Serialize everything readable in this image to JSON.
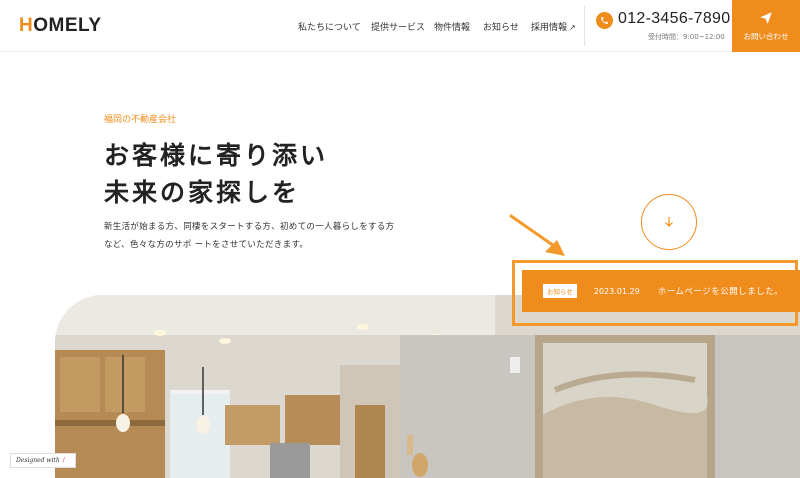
{
  "header": {
    "logo_first": "H",
    "logo_rest": "OMELY",
    "nav": [
      {
        "label": "私たちについて"
      },
      {
        "label": "提供サービス"
      },
      {
        "label": "物件情報"
      },
      {
        "label": "お知らせ"
      },
      {
        "label": "採用情報",
        "icon": "external-link-icon"
      }
    ],
    "phone": "012-3456-7890",
    "hours": "受付時間：9:00~12:00",
    "contact_label": "お問い合わせ"
  },
  "hero": {
    "eyebrow": "福岡の不動産会社",
    "headline": [
      "お客様に寄り添い",
      "未来の家探しを"
    ],
    "description": [
      "新生活が始まる方、同棲をスタートする方、初めての一人暮らしをする方",
      "など、色々な方のサポ ートをさせていただきます。"
    ]
  },
  "news": {
    "badge": "お知らせ",
    "date": "2023.01.29",
    "title": "ホームページを公開しました。"
  },
  "footer_badge": {
    "label": "Designed with"
  },
  "colors": {
    "accent": "#f08c1c",
    "highlight_outline": "#f39a2a"
  }
}
